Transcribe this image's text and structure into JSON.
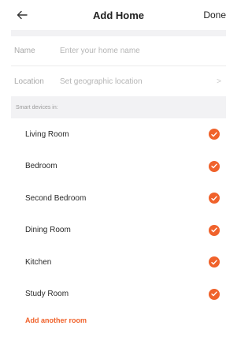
{
  "header": {
    "title": "Add Home",
    "done_label": "Done"
  },
  "form": {
    "name_label": "Name",
    "name_placeholder": "Enter your home name",
    "location_label": "Location",
    "location_value": "Set geographic location",
    "chevron": ">"
  },
  "rooms_section": {
    "header": "Smart devices in:",
    "rooms": [
      {
        "name": "Living Room",
        "checked": true
      },
      {
        "name": "Bedroom",
        "checked": true
      },
      {
        "name": "Second Bedroom",
        "checked": true
      },
      {
        "name": "Dining Room",
        "checked": true
      },
      {
        "name": "Kitchen",
        "checked": true
      },
      {
        "name": "Study Room",
        "checked": true
      }
    ],
    "add_room_label": "Add another room"
  },
  "colors": {
    "accent": "#f0622b",
    "section_bg": "#f2f2f4"
  },
  "icons": {
    "back": "back-arrow-icon",
    "check": "checkmark-icon"
  }
}
